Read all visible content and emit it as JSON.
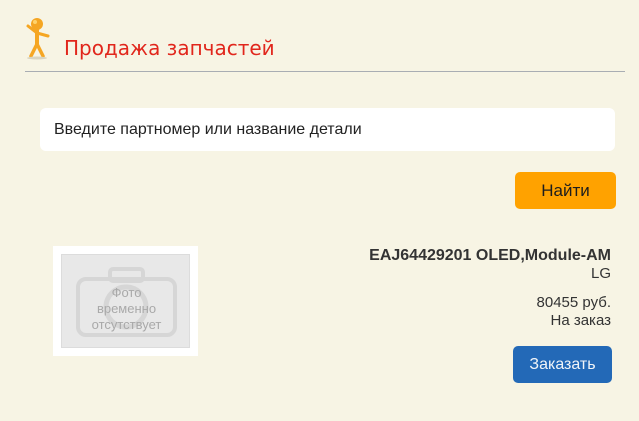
{
  "header": {
    "title": "Продажа запчастей",
    "mascot_icon": "stick-figure-mascot-icon"
  },
  "search": {
    "placeholder": "Введите партномер или название детали",
    "value": "",
    "button_label": "Найти"
  },
  "product": {
    "photo_placeholder": {
      "icon": "camera-icon",
      "lines": [
        "Фото",
        "временно",
        "отсутствует"
      ]
    },
    "part_name": "EAJ64429201 OLED,Module-AM",
    "brand": "LG",
    "price": "80455 руб.",
    "availability": "На заказ",
    "order_button_label": "Заказать"
  },
  "colors": {
    "background": "#f7f4e4",
    "title": "#e1261c",
    "find_button": "#ffa200",
    "order_button": "#2369b7"
  }
}
